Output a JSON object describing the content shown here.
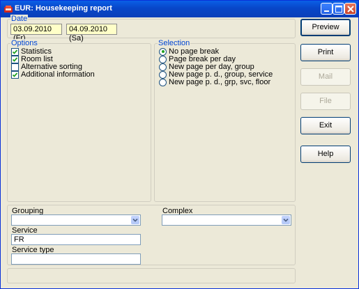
{
  "window": {
    "title": "EUR: Housekeeping report"
  },
  "date": {
    "legend": "Date",
    "from": "03.09.2010 (Fr)",
    "to": "04.09.2010 (Sa)"
  },
  "options": {
    "legend": "Options",
    "items": [
      {
        "label": "Statistics",
        "checked": true
      },
      {
        "label": "Room list",
        "checked": true
      },
      {
        "label": "Alternative sorting",
        "checked": false
      },
      {
        "label": "Additional information",
        "checked": true
      }
    ]
  },
  "selection": {
    "legend": "Selection",
    "items": [
      {
        "label": "No page break",
        "selected": true
      },
      {
        "label": "Page break per day",
        "selected": false
      },
      {
        "label": "New page per day, group",
        "selected": false
      },
      {
        "label": "New page p. d., group, service",
        "selected": false
      },
      {
        "label": "New page p. d., grp, svc, floor",
        "selected": false
      }
    ]
  },
  "buttons": {
    "preview": "Preview",
    "print": "Print",
    "mail": "Mail",
    "file": "File",
    "exit": "Exit",
    "help": "Help"
  },
  "filters": {
    "grouping_label": "Grouping",
    "grouping_value": "",
    "complex_label": "Complex",
    "complex_value": "",
    "service_label": "Service",
    "service_value": "FR",
    "service_type_label": "Service type",
    "service_type_value": ""
  },
  "status_bar": {
    "text": ""
  }
}
